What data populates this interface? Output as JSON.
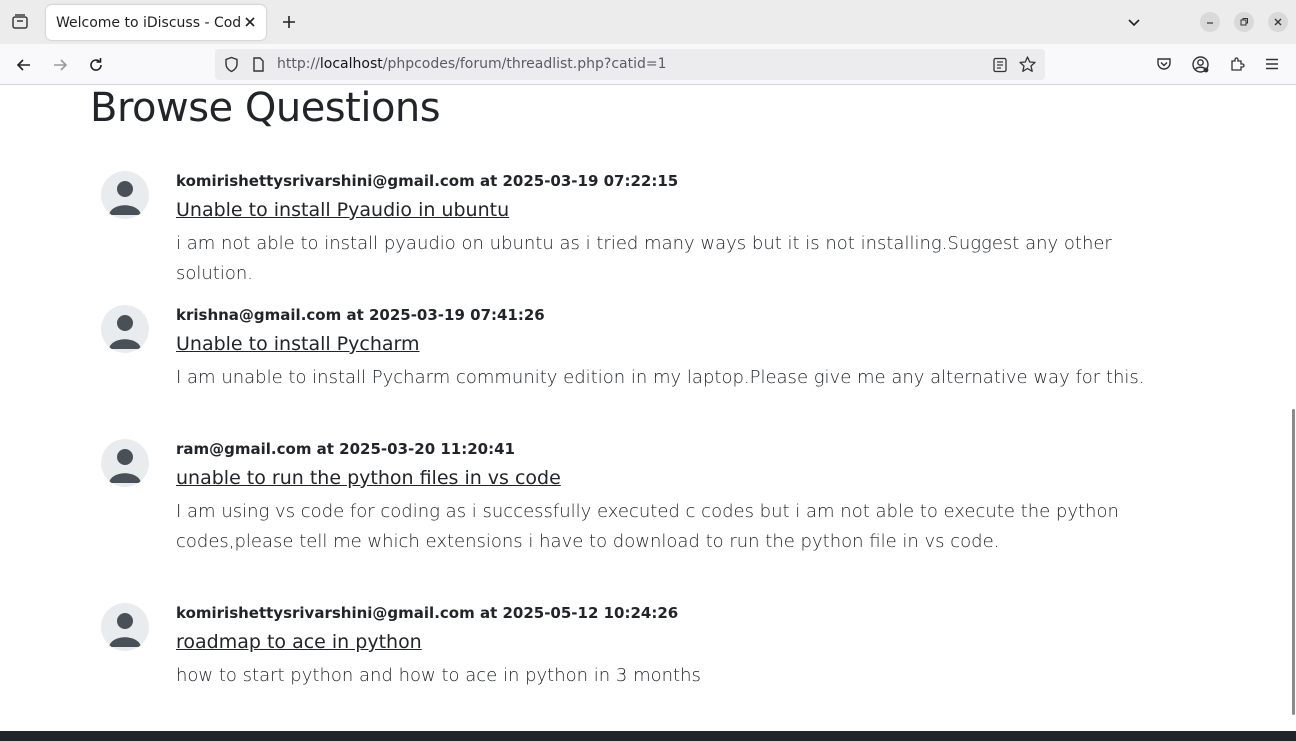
{
  "browser": {
    "tab_title": "Welcome to iDiscuss - Coding Forums",
    "url_prefix": "http://",
    "url_host": "localhost",
    "url_path": "/phpcodes/forum/threadlist.php?catid=1"
  },
  "page": {
    "heading": "Browse Questions"
  },
  "threads": [
    {
      "meta": "komirishettysrivarshini@gmail.com at 2025-03-19 07:22:15",
      "title": "Unable to install Pyaudio in ubuntu",
      "description": "i am not able to install pyaudio on ubuntu as i tried many ways but it is not installing.Suggest any other solution."
    },
    {
      "meta": "krishna@gmail.com at 2025-03-19 07:41:26",
      "title": "Unable to install Pycharm",
      "description": "I am unable to install Pycharm community edition in my laptop.Please give me any alternative way for this."
    },
    {
      "meta": "ram@gmail.com at 2025-03-20 11:20:41",
      "title": "unable to run the python files in vs code",
      "description": "I am using vs code for coding as i successfully executed c codes but i am not able to execute the python codes,please tell me which extensions i have to download to run the python file in vs code."
    },
    {
      "meta": "komirishettysrivarshini@gmail.com at 2025-05-12 10:24:26",
      "title": "roadmap to ace in python",
      "description": "how to start python and how to ace in python in 3 months"
    }
  ],
  "colors": {
    "text": "#212529",
    "avatar_fill": "#495057",
    "footer": "#212529"
  },
  "icons": {
    "avatar": "user-avatar-icon"
  }
}
